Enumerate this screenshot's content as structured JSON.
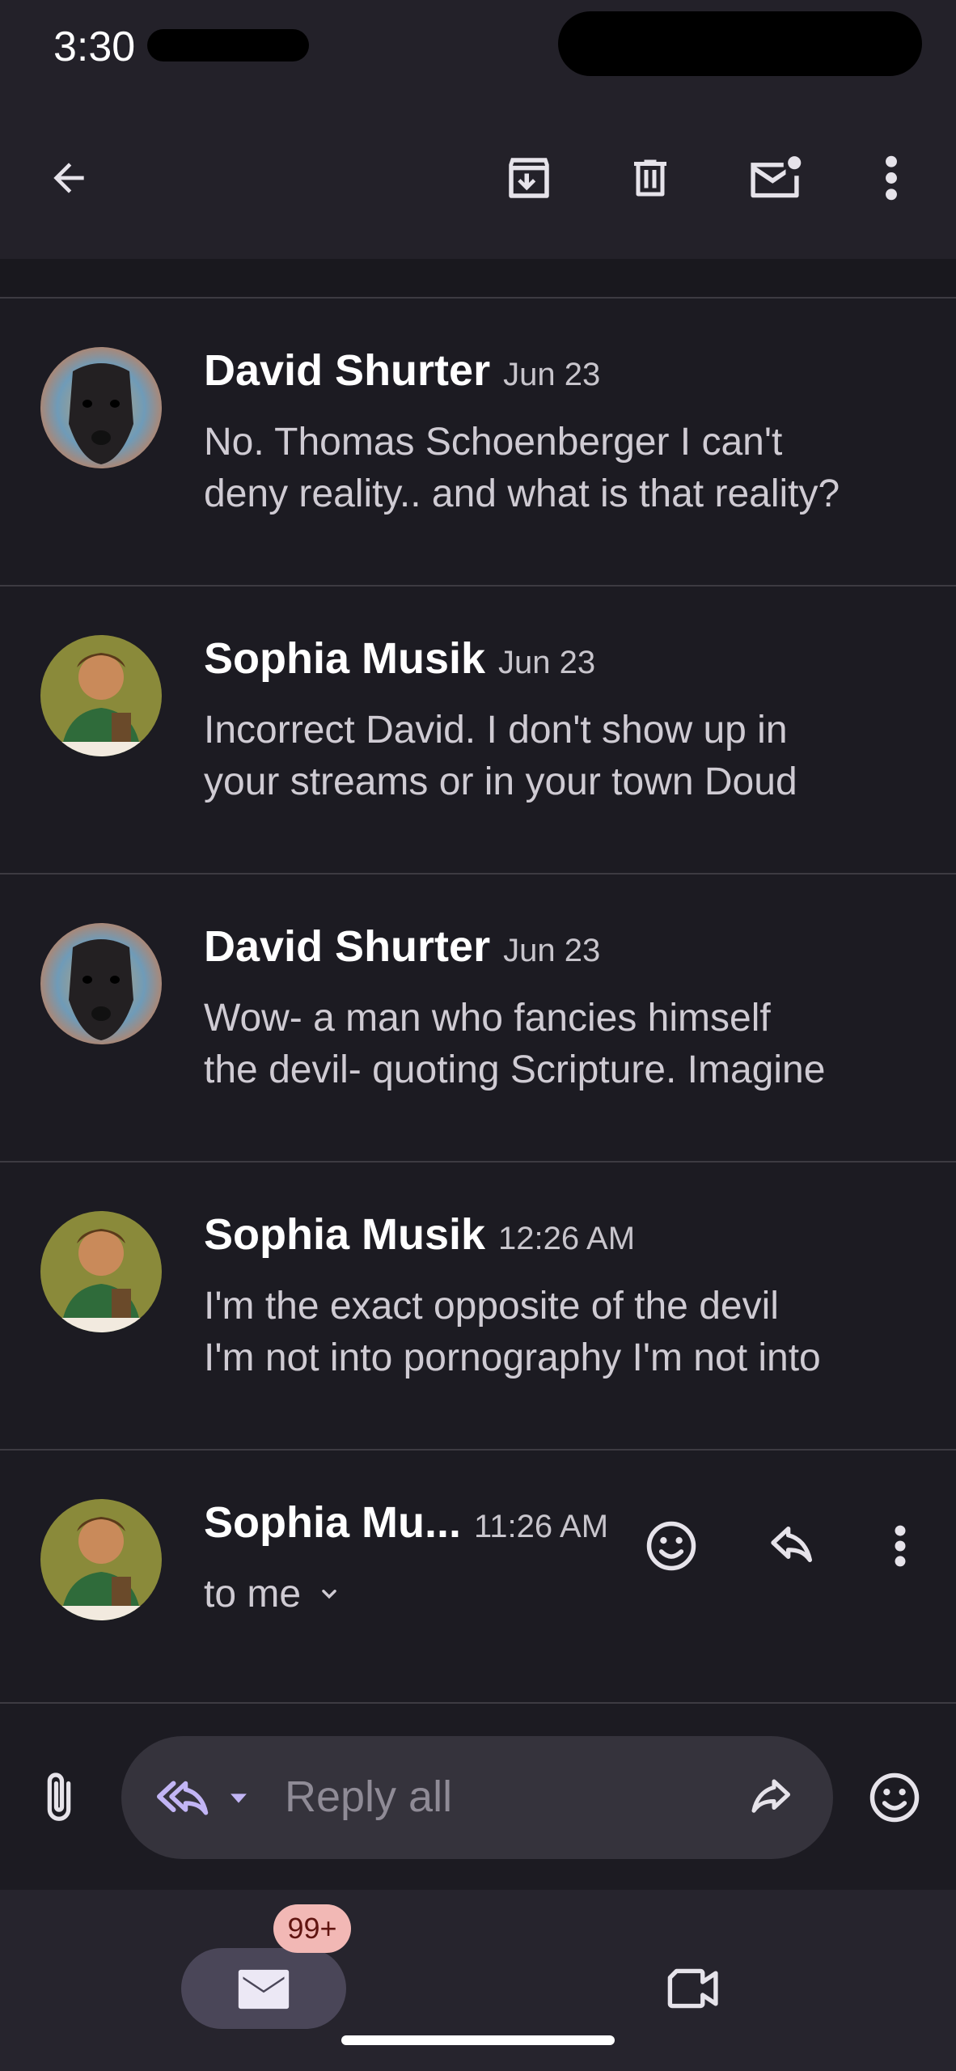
{
  "status_bar": {
    "time": "3:30"
  },
  "toolbar": {
    "back_icon": "arrow-back-icon",
    "archive_icon": "archive-icon",
    "delete_icon": "trash-icon",
    "mark_unread_icon": "mail-unread-icon",
    "more_icon": "more-vert-icon"
  },
  "messages": [
    {
      "sender": "David Shurter",
      "date": "Jun 23",
      "line1": "No. Thomas Schoenberger I can't",
      "line2": "deny reality.. and what is that reality?"
    },
    {
      "sender": "Sophia Musik",
      "date": "Jun 23",
      "line1": "Incorrect David. I don't show up in",
      "line2": "your streams or in your town Doud"
    },
    {
      "sender": "David Shurter",
      "date": "Jun 23",
      "line1": "Wow- a man who fancies himself",
      "line2": "the devil- quoting Scripture. Imagine"
    },
    {
      "sender": "Sophia Musik",
      "date": "12:26 AM",
      "line1": "I'm the exact opposite of the devil",
      "line2": "I'm not into pornography I'm not into"
    }
  ],
  "expanded_message": {
    "sender": "Sophia Mu...",
    "time": "11:26 AM",
    "recipient": "to me"
  },
  "reply_bar": {
    "placeholder": "Reply all"
  },
  "bottom_nav": {
    "mail_badge": "99+"
  },
  "colors": {
    "background": "#1c1b22",
    "accent": "#c2b5f5",
    "badge": "#f2b8b5"
  }
}
